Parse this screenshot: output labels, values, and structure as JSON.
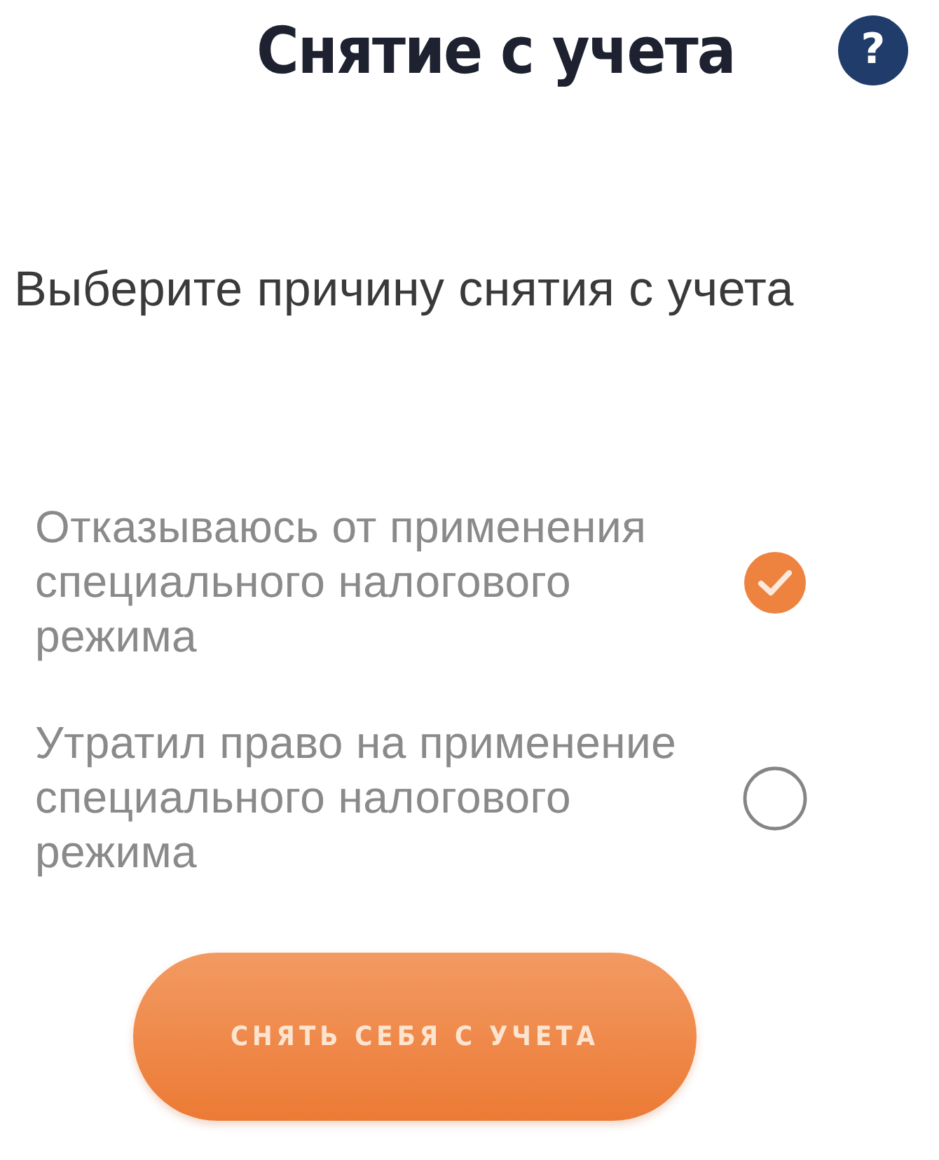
{
  "header": {
    "title": "Снятие с учета",
    "help_button": {
      "label": "?"
    }
  },
  "prompt": "Выберите причину снятия с учета",
  "options": [
    {
      "label": "Отказываюсь от применения специального налогового режима",
      "selected": true
    },
    {
      "label": "Утратил право на применение специального налогового режима",
      "selected": false
    }
  ],
  "submit_button": {
    "label": "СНЯТЬ СЕБЯ С УЧЕТА"
  }
}
